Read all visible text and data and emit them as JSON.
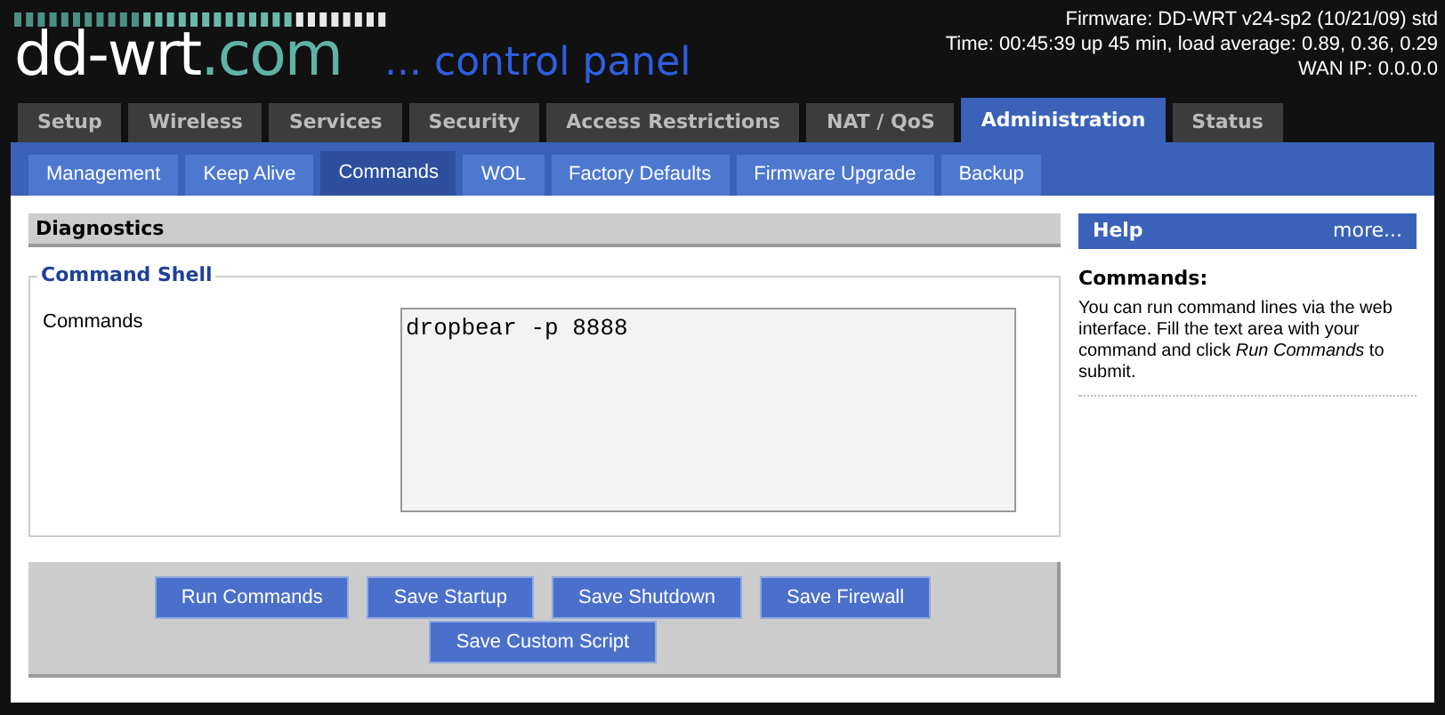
{
  "header": {
    "logo_name": "dd-wrt",
    "logo_suffix": ".com",
    "tagline": "... control panel",
    "firmware": "Firmware: DD-WRT v24-sp2 (10/21/09) std",
    "time": "Time: 00:45:39 up 45 min, load average: 0.89, 0.36, 0.29",
    "wan_ip": "WAN IP: 0.0.0.0"
  },
  "tabs": [
    {
      "label": "Setup",
      "selected": false
    },
    {
      "label": "Wireless",
      "selected": false
    },
    {
      "label": "Services",
      "selected": false
    },
    {
      "label": "Security",
      "selected": false
    },
    {
      "label": "Access Restrictions",
      "selected": false
    },
    {
      "label": "NAT / QoS",
      "selected": false
    },
    {
      "label": "Administration",
      "selected": true
    },
    {
      "label": "Status",
      "selected": false
    }
  ],
  "subtabs": [
    {
      "label": "Management",
      "selected": false
    },
    {
      "label": "Keep Alive",
      "selected": false
    },
    {
      "label": "Commands",
      "selected": true
    },
    {
      "label": "WOL",
      "selected": false
    },
    {
      "label": "Factory Defaults",
      "selected": false
    },
    {
      "label": "Firmware Upgrade",
      "selected": false
    },
    {
      "label": "Backup",
      "selected": false
    }
  ],
  "section": {
    "title": "Diagnostics",
    "legend": "Command Shell",
    "field_label": "Commands",
    "value": "dropbear -p 8888"
  },
  "help": {
    "title": "Help",
    "more": "more...",
    "heading": "Commands:",
    "text": "You can run command lines via the web interface. Fill the text area with your command and click *Run Commands* to submit."
  },
  "buttons": [
    "Run Commands",
    "Save Startup",
    "Save Shutdown",
    "Save Firewall",
    "Save Custom Script"
  ]
}
